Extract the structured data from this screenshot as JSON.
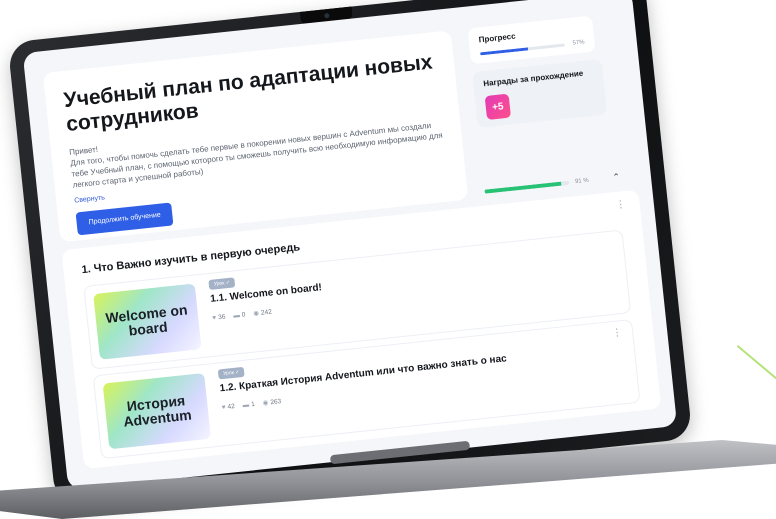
{
  "header": {
    "title": "Учебный план по адаптации новых сотрудников",
    "greeting": "Привет!",
    "description": "Для того, чтобы помочь сделать тебе первые в покорении новых вершин с Adventum мы создали тебе Учебный план, с помощью которого ты сможешь получить всю необходимую информацию для легкого старта и успешной работы)",
    "collapse_label": "Свернуть",
    "cta_label": "Продолжить обучение"
  },
  "progress": {
    "title": "Прогресс",
    "percent_label": "57%",
    "value": 0.57,
    "bar_color": "#2f5fe6"
  },
  "awards": {
    "title": "Награды за прохождение",
    "badge_label": "+5"
  },
  "section": {
    "progress_label": "91 %",
    "progress_value": 0.91,
    "progress_color": "#27c274",
    "title": "1. Что Важно изучить в первую очередь",
    "chevron_icon": "chevron-up-icon",
    "menu_icon": "more-vertical-icon"
  },
  "lessons": [
    {
      "tag": "Урок ✓",
      "title": "1.1. Welcome on board!",
      "thumb_text": "Welcome on board",
      "likes": "36",
      "comments": "0",
      "views": "242"
    },
    {
      "tag": "Урок ✓",
      "title": "1.2. Краткая История Adventum или что важно знать о нас",
      "thumb_text": "История Adventum",
      "likes": "42",
      "comments": "1",
      "views": "263"
    }
  ],
  "icons": {
    "likes": "heart-icon",
    "comments": "comment-icon",
    "views": "eye-icon"
  }
}
